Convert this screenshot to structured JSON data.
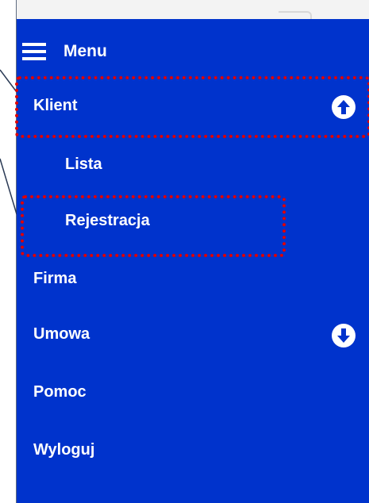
{
  "menu": {
    "title": "Menu",
    "items": [
      {
        "label": "Klient",
        "arrow": "arrow-up-icon"
      },
      {
        "label": "Lista"
      },
      {
        "label": "Rejestracja"
      },
      {
        "label": "Firma"
      },
      {
        "label": "Umowa",
        "arrow": "arrow-down-icon"
      },
      {
        "label": "Pomoc"
      },
      {
        "label": "Wyloguj"
      }
    ]
  },
  "colors": {
    "menu_background": "#0033cc",
    "text": "#ffffff",
    "highlight": "#e00000"
  }
}
